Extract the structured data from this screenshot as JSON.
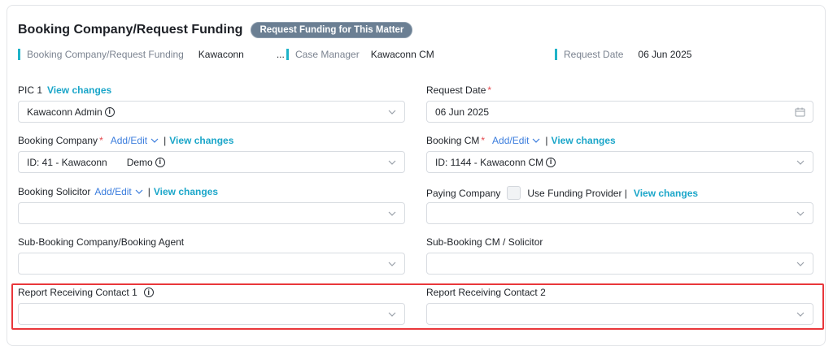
{
  "header": {
    "title": "Booking Company/Request Funding",
    "request_funding_button": "Request Funding for This Matter"
  },
  "meta": {
    "booking_company_label": "Booking Company/Request Funding",
    "booking_company_value": "Kawaconn",
    "booking_company_ellipsis": "...",
    "case_manager_label": "Case Manager",
    "case_manager_value": "Kawaconn CM",
    "request_date_label": "Request Date",
    "request_date_value": "06 Jun 2025"
  },
  "fields": {
    "pic1": {
      "label": "PIC 1",
      "link": "View changes",
      "value": "Kawaconn Admin"
    },
    "request_date": {
      "label": "Request Date",
      "value": "06 Jun 2025"
    },
    "booking_company": {
      "label": "Booking Company",
      "addedit": "Add/Edit",
      "pipe": "|",
      "link": "View changes",
      "value_id": "ID: 41 - Kawaconn",
      "value_extra": "Demo"
    },
    "booking_cm": {
      "label": "Booking CM",
      "addedit": "Add/Edit",
      "pipe": "|",
      "link": "View changes",
      "value": "ID: 1144 - Kawaconn CM"
    },
    "booking_solicitor": {
      "label": "Booking Solicitor",
      "addedit": "Add/Edit",
      "pipe": "|",
      "link": "View changes",
      "value": ""
    },
    "paying_company": {
      "label": "Paying Company",
      "checkbox_label": "Use Funding Provider |",
      "link": "View changes",
      "value": ""
    },
    "sub_booking_company": {
      "label": "Sub-Booking Company/Booking Agent",
      "value": ""
    },
    "sub_booking_cm": {
      "label": "Sub-Booking CM / Solicitor",
      "value": ""
    },
    "report_contact_1": {
      "label": "Report Receiving Contact 1",
      "value": ""
    },
    "report_contact_2": {
      "label": "Report Receiving Contact 2",
      "value": ""
    }
  },
  "icons": {
    "info": "i",
    "required_mark": "*"
  },
  "colors": {
    "accent_bar": "#1fb3c8",
    "link": "#1ba6c9",
    "addedit": "#3b7ddd",
    "required": "#e5484d",
    "pill": "#6b7f93",
    "highlight": "#e9373b"
  }
}
